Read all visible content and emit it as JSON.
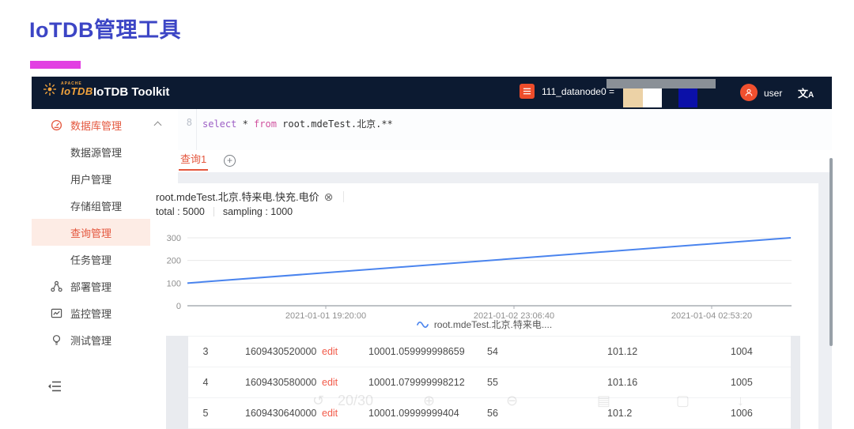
{
  "page": {
    "title": "IoTDB管理工具"
  },
  "theme": {
    "accent": "#e4573e",
    "navbar_bg": "#0c1a31",
    "title_color": "#3c45c5",
    "magenta_bar": "#e23fe2",
    "chart_line": "#4a84ee",
    "logo_orange": "#f2a33c",
    "avatar_orange": "#f0502f",
    "doc_icon_bg": "#ee4c2a"
  },
  "navbar": {
    "logo_apache": "APACHE",
    "logo_name": "IoTDB",
    "brand": "IoTDB Toolkit",
    "node_label": "111_datanode0 =",
    "user": "user",
    "translate_glyph": "文",
    "translate_sub": "A",
    "swatches": {
      "bar": "#8a9097",
      "blocks": [
        "#ecd2a6",
        "#ffffff",
        "#0b10a8"
      ]
    }
  },
  "sidebar": {
    "items": [
      {
        "label": "数据库管理",
        "icon": "gauge-icon",
        "level": 1,
        "group": true,
        "expanded": true
      },
      {
        "label": "数据源管理",
        "level": 2
      },
      {
        "label": "用户管理",
        "level": 2
      },
      {
        "label": "存储组管理",
        "level": 2
      },
      {
        "label": "查询管理",
        "level": 2,
        "active": true
      },
      {
        "label": "任务管理",
        "level": 2
      },
      {
        "label": "部署管理",
        "icon": "deploy-icon",
        "level": 1
      },
      {
        "label": "监控管理",
        "icon": "monitor-icon",
        "level": 1
      },
      {
        "label": "测试管理",
        "icon": "test-icon",
        "level": 1
      }
    ]
  },
  "editor": {
    "line_number": "8",
    "sql_select": "select",
    "sql_star": " * ",
    "sql_from": "from",
    "sql_rest": " root.mdeTest.北京.**"
  },
  "tabs": {
    "active": "查询1"
  },
  "result": {
    "title": "root.mdeTest.北京.特来电.快充.电价",
    "total": "total : 5000",
    "sampling": "sampling : 1000"
  },
  "chart_data": {
    "type": "line",
    "title": "root.mdeTest.北京.特来电.快充.电价",
    "total": 5000,
    "sampling": 1000,
    "y_ticks": [
      0,
      100,
      200,
      300
    ],
    "ylim": [
      0,
      300
    ],
    "x_ticks": [
      "2021-01-01 19:20:00",
      "2021-01-02 23:06:40",
      "2021-01-04 02:53:20"
    ],
    "grid": true,
    "legend_position": "bottom",
    "series": [
      {
        "name": "root.mdeTest.北京.特来电....",
        "color": "#4a84ee",
        "points_norm": [
          [
            0,
            100
          ],
          [
            1,
            300
          ]
        ]
      }
    ]
  },
  "table": {
    "rows": [
      [
        "3",
        "1609430520000",
        "edit",
        "10001.059999998659",
        "54",
        "101.12",
        "1004"
      ],
      [
        "4",
        "1609430580000",
        "edit",
        "10001.079999998212",
        "55",
        "101.16",
        "1005"
      ],
      [
        "5",
        "1609430640000",
        "edit",
        "10001.09999999404",
        "56",
        "101.2",
        "1006"
      ]
    ]
  },
  "watermark": {
    "items": [
      {
        "glyph": "↺",
        "x": 205
      },
      {
        "glyph": "20/30",
        "x": 237
      },
      {
        "glyph": "⊕",
        "x": 345
      },
      {
        "glyph": "⊖",
        "x": 450
      },
      {
        "glyph": "▤",
        "x": 565
      },
      {
        "glyph": "▢",
        "x": 665
      },
      {
        "glyph": "↓",
        "x": 742
      }
    ]
  }
}
